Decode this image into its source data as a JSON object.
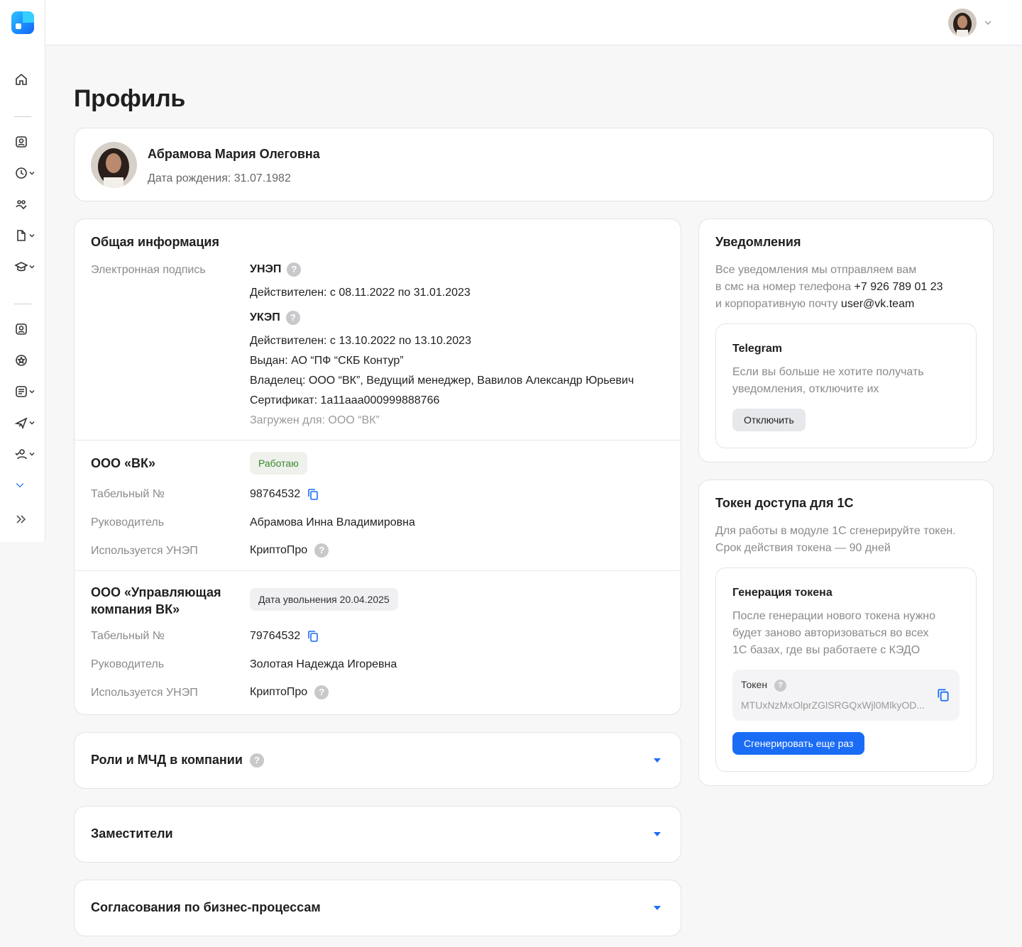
{
  "page": {
    "title": "Профиль"
  },
  "profile": {
    "name": "Абрамова Мария Олеговна",
    "dob": "Дата рождения: 31.07.1982"
  },
  "general": {
    "title": "Общая информация",
    "esign_label": "Электронная подпись",
    "unep": {
      "name": "УНЭП",
      "valid": "Действителен: с 08.11.2022 по 31.01.2023"
    },
    "ukep": {
      "name": "УКЭП",
      "valid": "Действителен: с 13.10.2022 по 13.10.2023",
      "issued": "Выдан: АО “ПФ “СКБ Контур”",
      "owner": "Владелец: ООО “ВК”, Ведущий менеджер, Вавилов Александр Юрьевич",
      "cert": "Сертификат: 1a11aaa000999888766",
      "loaded": "Загружен для: ООО “ВК”"
    }
  },
  "companies": [
    {
      "name": "ООО «ВК»",
      "badge": "Работаю",
      "tab_label": "Табельный №",
      "tab_value": "98764532",
      "manager_label": "Руководитель",
      "manager_value": "Абрамова Инна Владимировна",
      "unep_label": "Используется УНЭП",
      "unep_value": "КриптоПро"
    },
    {
      "name_line1": "ООО «Управляющая",
      "name_line2": "компания ВК»",
      "badge": "Дата увольнения 20.04.2025",
      "tab_label": "Табельный №",
      "tab_value": "79764532",
      "manager_label": "Руководитель",
      "manager_value": "Золотая Надежда Игоревна",
      "unep_label": "Используется УНЭП",
      "unep_value": "КриптоПро"
    }
  ],
  "sections": {
    "roles": "Роли и МЧД в компании",
    "deputies": "Заместители",
    "approvals": "Согласования по бизнес-процессам"
  },
  "notifications": {
    "title": "Уведомления",
    "line1": "Все уведомления мы отправляем вам",
    "line2_prefix": "в смс на номер телефона ",
    "phone": "+7 926 789 01 23",
    "line3_prefix": "и корпоративную почту ",
    "email": "user@vk.team",
    "telegram": {
      "title": "Telegram",
      "text1": "Если вы больше не хотите получать",
      "text2": "уведомления, отключите их",
      "button": "Отключить"
    }
  },
  "token": {
    "title": "Токен доступа для 1С",
    "text1": "Для работы в модуле 1С сгенерируйте токен.",
    "text2": "Срок действия токена — 90 дней",
    "gen": {
      "title": "Генерация токена",
      "text1": "После генерации нового токена нужно",
      "text2": "будет заново авторизоваться во всех",
      "text3": "1С базах, где вы работаете с КЭДО",
      "label": "Токен",
      "value": "MTUxNzMxOlprZGlSRGQxWjl0MlkyOD...",
      "button": "Сгенерировать еще раз"
    }
  },
  "colors": {
    "accent": "#1a6cf5",
    "working_badge": "#3c8a2e"
  }
}
